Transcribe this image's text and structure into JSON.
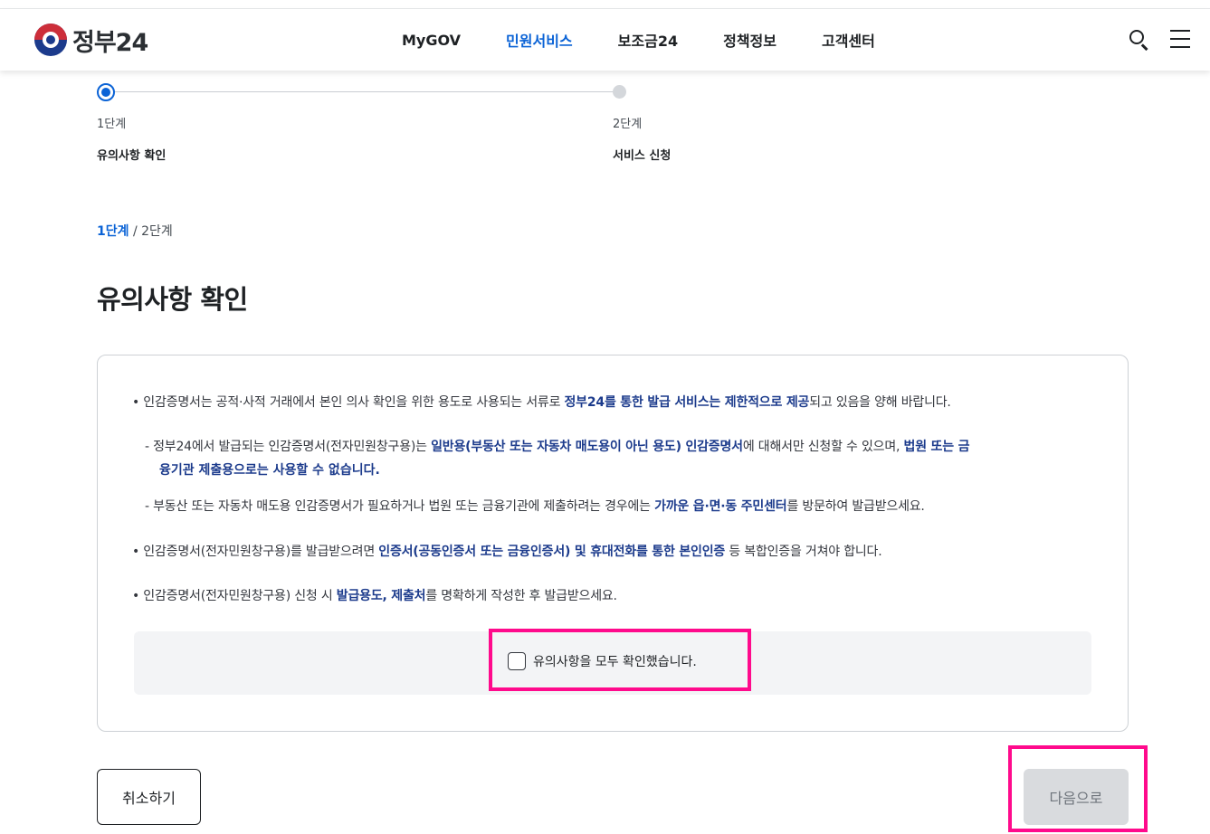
{
  "header": {
    "logo_text": "정부24",
    "nav": [
      "MyGOV",
      "민원서비스",
      "보조금24",
      "정책정보",
      "고객센터"
    ],
    "active_nav": 1
  },
  "stepper": {
    "steps": [
      {
        "num": "1단계",
        "name": "유의사항 확인"
      },
      {
        "num": "2단계",
        "name": "서비스 신청"
      }
    ]
  },
  "breadcrumb": {
    "current": "1단계",
    "sep": "/",
    "next": "2단계"
  },
  "page_title": "유의사항 확인",
  "notice": {
    "b1": {
      "pre": "• 인감증명서는 공적·사적 거래에서 본인 의사 확인을 위한 용도로 사용되는 서류로 ",
      "hl": "정부24를 통한 발급 서비스는 제한적으로 제공",
      "post": "되고 있음을 양해 바랍니다."
    },
    "s1": {
      "pre": "- 정부24에서 발급되는 인감증명서(전자민원창구용)는 ",
      "hl1": "일반용(부동산 또는 자동차 매도용이 아닌 용도) 인감증명서",
      "mid": "에 대해서만 신청할 수 있으며, ",
      "hl2": "법원 또는 금",
      "cont": "융기관 제출용으로는 사용할 수 없습니다."
    },
    "s2": {
      "pre": "- 부동산 또는 자동차 매도용 인감증명서가 필요하거나 법원 또는 금융기관에 제출하려는 경우에는 ",
      "hl": "가까운 읍·면·동 주민센터",
      "post": "를 방문하여 발급받으세요."
    },
    "b2": {
      "pre": "• 인감증명서(전자민원창구용)를 발급받으려면 ",
      "hl": "인증서(공동인증서 또는 금융인증서) 및 휴대전화를 통한 본인인증",
      "post": " 등 복합인증을 거쳐야 합니다."
    },
    "b3": {
      "pre": "• 인감증명서(전자민원창구용) 신청 시 ",
      "hl": "발급용도, 제출처",
      "post": "를 명확하게 작성한 후 발급받으세요."
    },
    "agree_label": "유의사항을 모두 확인했습니다."
  },
  "buttons": {
    "cancel": "취소하기",
    "next": "다음으로"
  },
  "colors": {
    "accent": "#0b63d6",
    "highlight_text": "#1c3b8c",
    "annotation": "#ff0a8c"
  }
}
